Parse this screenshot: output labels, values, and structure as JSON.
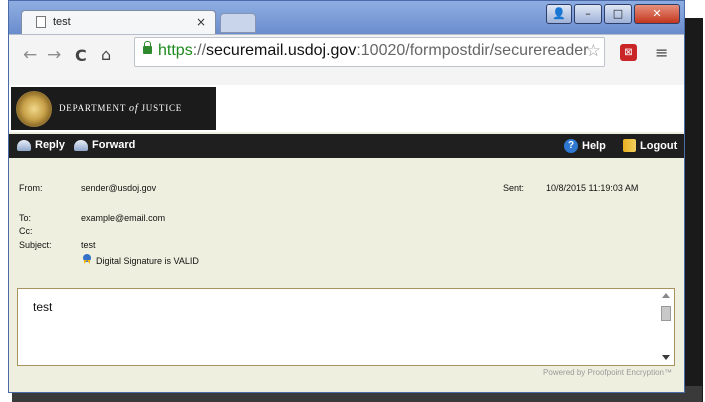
{
  "browser": {
    "tab_title": "test",
    "tab_close": "×",
    "url_scheme": "https",
    "url_sep": "://",
    "url_host": "securemail.usdoj.gov",
    "url_rest": ":10020/formpostdir/securereader",
    "nav_back": "←",
    "nav_forward": "→",
    "nav_reload": "C",
    "nav_home": "⌂",
    "bookmark_star": "☆",
    "menu": "≡",
    "window_buttons": {
      "user": "👤",
      "minimize": "–",
      "maximize": "□",
      "close": "✕"
    }
  },
  "header": {
    "org_name_1": "DEPARTMENT",
    "org_name_of": "of",
    "org_name_2": "JUSTICE"
  },
  "actions": {
    "reply": "Reply",
    "forward": "Forward",
    "help": "Help",
    "logout": "Logout"
  },
  "message": {
    "from_label": "From:",
    "from_value": "sender@usdoj.gov",
    "sent_label": "Sent:",
    "sent_value": "10/8/2015 11:19:03 AM",
    "to_label": "To:",
    "to_value": "example@email.com",
    "cc_label": "Cc:",
    "subject_label": "Subject:",
    "subject_value": "test",
    "signature_status": "Digital Signature is VALID",
    "body": "test"
  },
  "footer": {
    "powered_by": "Powered by Proofpoint Encryption™"
  },
  "icons": [
    "document-icon",
    "back-arrow-icon",
    "forward-arrow-icon",
    "reload-icon",
    "home-icon",
    "lock-icon",
    "star-icon",
    "extension-icon",
    "menu-icon",
    "seal-icon",
    "reply-icon",
    "forward-icon",
    "help-icon",
    "logout-icon",
    "ribbon-icon"
  ],
  "colors": {
    "action_bar": "#1f1f1f",
    "content_bg": "#efefdf",
    "url_scheme": "#1e8b1e"
  }
}
